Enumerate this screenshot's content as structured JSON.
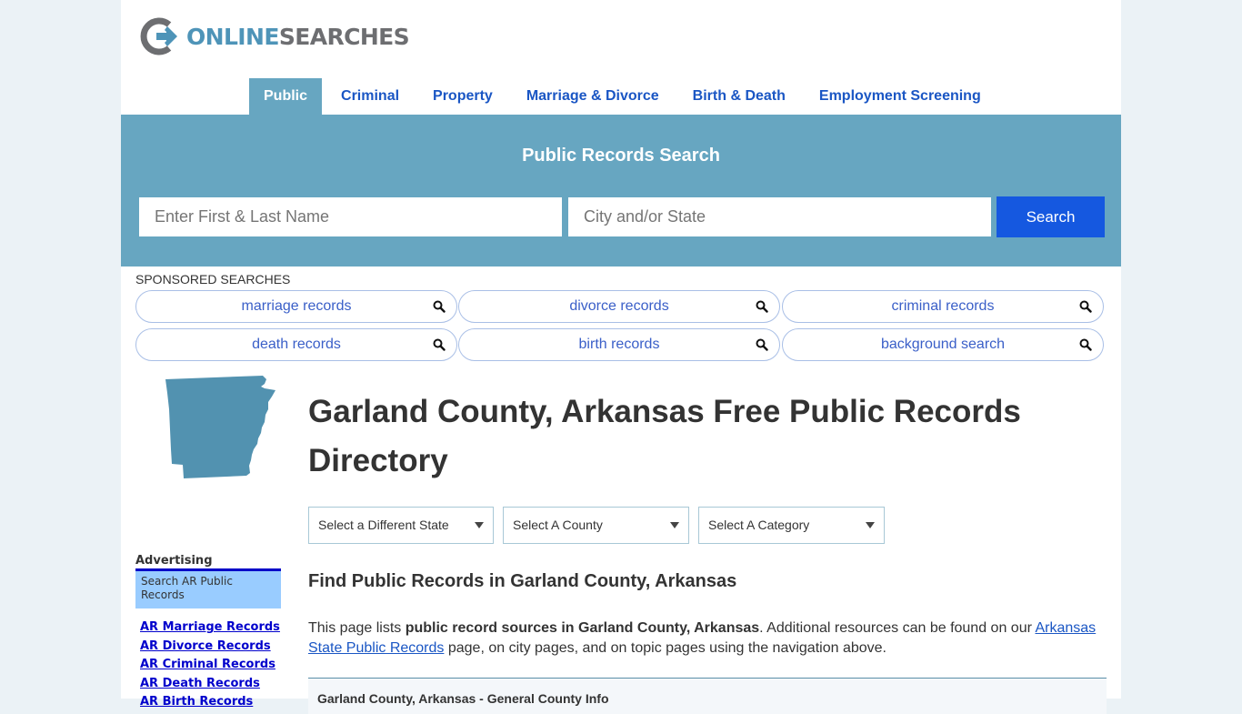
{
  "brand": {
    "name_part1": "ONLINE",
    "name_part2": "SEARCHES",
    "colors": {
      "blue": "#4e94b8",
      "gray": "#6d6e71"
    }
  },
  "nav": {
    "items": [
      {
        "label": "Public",
        "active": true
      },
      {
        "label": "Criminal",
        "active": false
      },
      {
        "label": "Property",
        "active": false
      },
      {
        "label": "Marriage & Divorce",
        "active": false
      },
      {
        "label": "Birth & Death",
        "active": false
      },
      {
        "label": "Employment Screening",
        "active": false
      }
    ]
  },
  "search": {
    "title": "Public Records Search",
    "name_placeholder": "Enter First & Last Name",
    "location_placeholder": "City and/or State",
    "button_label": "Search",
    "colors": {
      "band": "#67a6c1",
      "button": "#1558e0"
    }
  },
  "sponsored": {
    "label": "SPONSORED SEARCHES",
    "items": [
      {
        "label": "marriage records",
        "icon": "search-icon"
      },
      {
        "label": "divorce records",
        "icon": "search-icon"
      },
      {
        "label": "criminal records",
        "icon": "search-icon"
      },
      {
        "label": "death records",
        "icon": "search-icon"
      },
      {
        "label": "birth records",
        "icon": "search-icon"
      },
      {
        "label": "background search",
        "icon": "search-icon"
      }
    ]
  },
  "main": {
    "title": "Garland County, Arkansas Free Public Records Directory",
    "selects": [
      {
        "value": "Select a Different State"
      },
      {
        "value": "Select A County"
      },
      {
        "value": "Select A Category"
      }
    ],
    "subtitle": "Find Public Records in Garland County, Arkansas",
    "intro": {
      "text1": "This page lists ",
      "bold": "public record sources in Garland County, Arkansas",
      "text2": ". Additional resources can be found on our ",
      "link": "Arkansas State Public Records",
      "text3": " page, on city pages, and on topic pages using the navigation above."
    },
    "info_box_title": "Garland County, Arkansas - General County Info"
  },
  "sidebar": {
    "advertising_label": "Advertising",
    "ad_box_text": "Search AR Public Records",
    "links": [
      "AR Marriage Records",
      "AR Divorce Records",
      "AR Criminal Records",
      "AR Death Records",
      "AR Birth Records"
    ]
  }
}
